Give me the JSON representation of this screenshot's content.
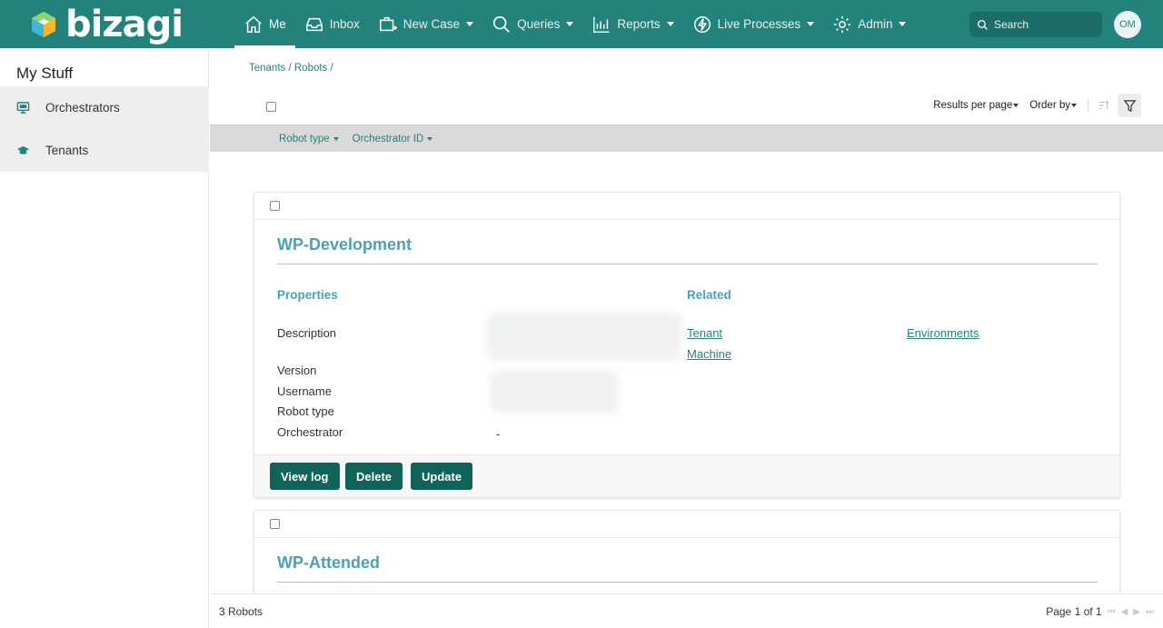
{
  "brand": {
    "name": "bizagi"
  },
  "nav": {
    "me": "Me",
    "inbox": "Inbox",
    "new_case": "New Case",
    "queries": "Queries",
    "reports": "Reports",
    "live_processes": "Live Processes",
    "admin": "Admin"
  },
  "search": {
    "placeholder": "Search"
  },
  "user": {
    "initials": "OM"
  },
  "sidebar": {
    "title": "My Stuff",
    "items": [
      {
        "label": "Orchestrators",
        "icon": "monitor-icon"
      },
      {
        "label": "Tenants",
        "icon": "graduation-cap-icon"
      }
    ]
  },
  "breadcrumb": {
    "tenants": "Tenants",
    "sep1": " / ",
    "robots": "Robots",
    "sep2": " /"
  },
  "toolbar": {
    "results_per_page": "Results per page",
    "order_by": "Order by"
  },
  "filters": {
    "robot_type": "Robot type",
    "orchestrator_id": "Orchestrator ID"
  },
  "cards": [
    {
      "title": "WP-Development",
      "properties_heading": "Properties",
      "related_heading": "Related",
      "properties": {
        "description": "Description",
        "version": "Version",
        "username": "Username",
        "robot_type": "Robot type",
        "orchestrator": "Orchestrator",
        "orchestrator_value": "-"
      },
      "related": {
        "tenant": "Tenant",
        "machine": "Machine",
        "environments": "Environments"
      },
      "buttons": {
        "view_log": "View log",
        "delete": "Delete",
        "update": "Update"
      }
    },
    {
      "title": "WP-Attended"
    }
  ],
  "footer": {
    "count": "3 Robots",
    "page": "Page 1 of 1"
  },
  "colors": {
    "brand": "#23837c",
    "title": "#4ba0b6",
    "button": "#0f6358"
  }
}
